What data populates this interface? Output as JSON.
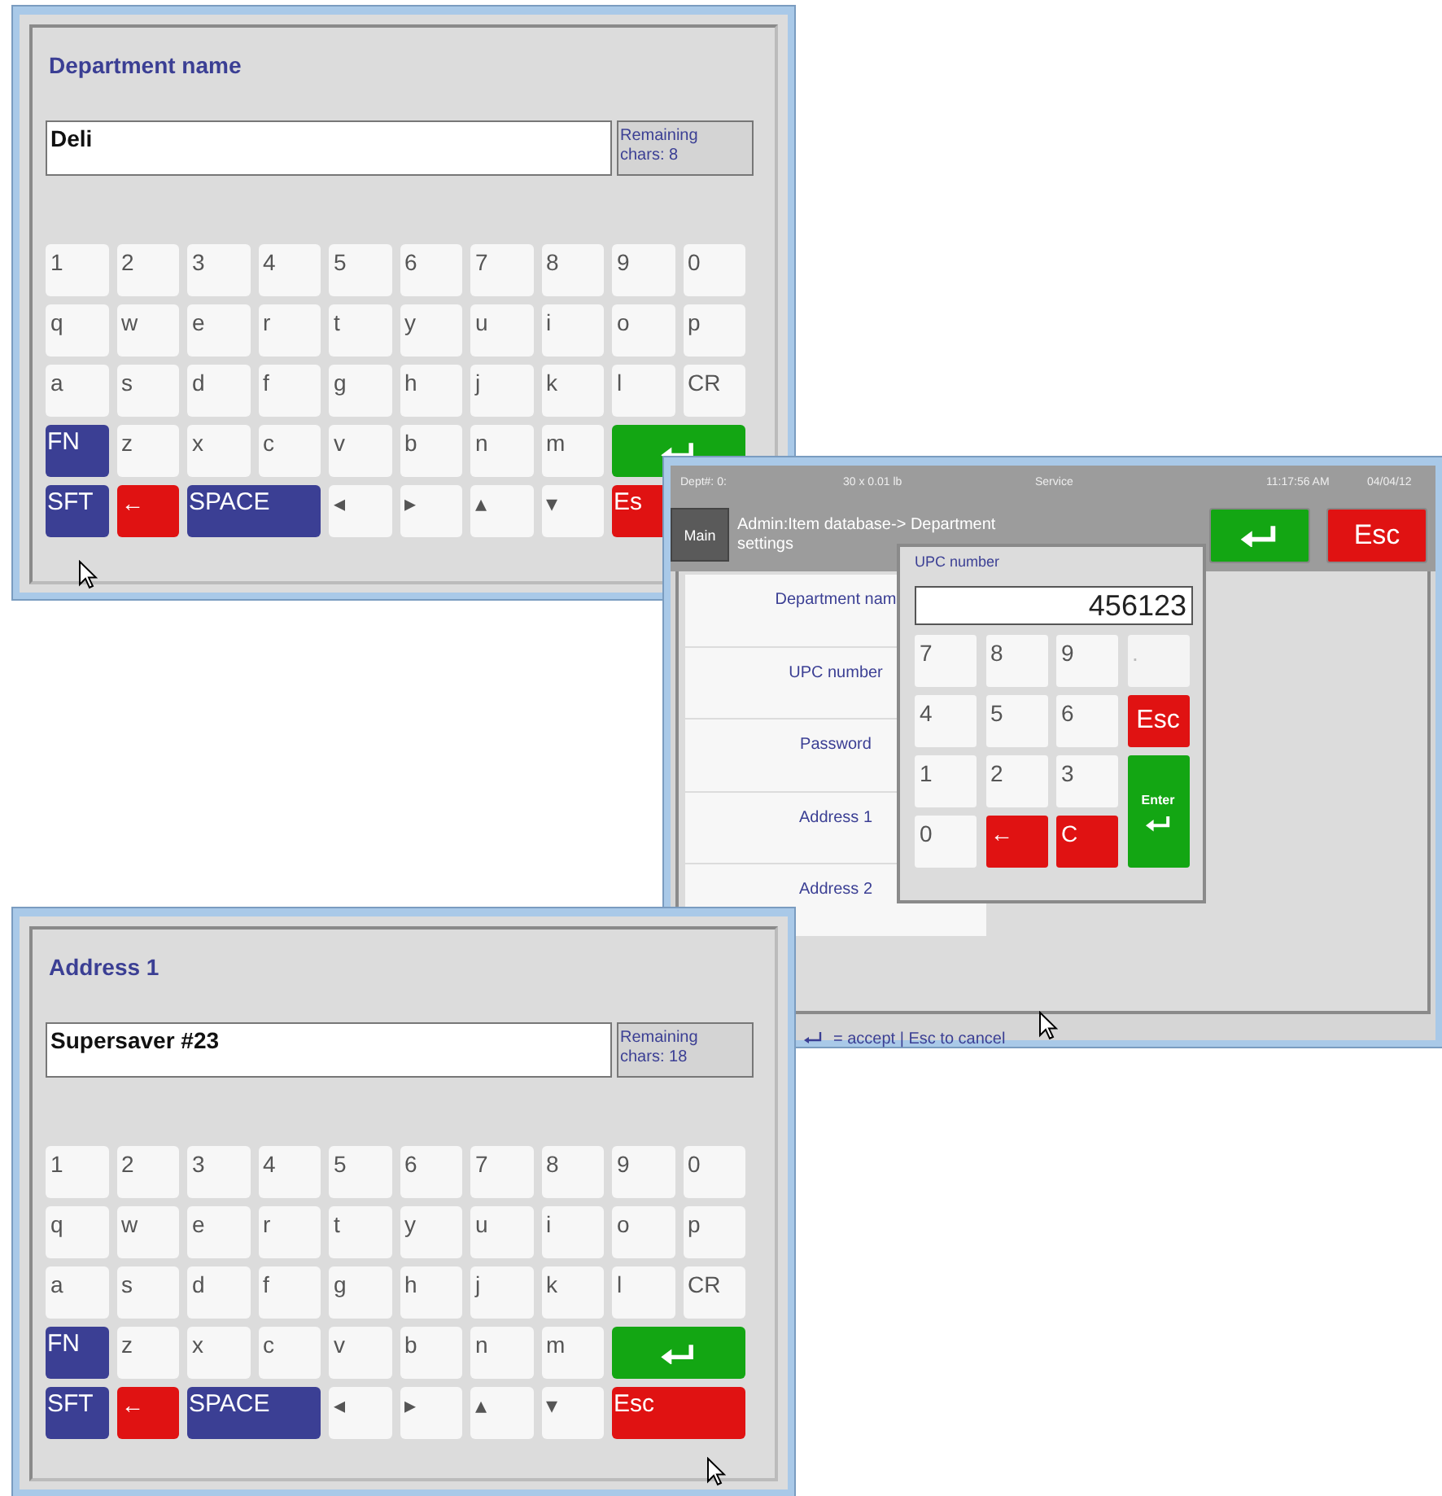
{
  "keyboard_window_1": {
    "title": "Department name",
    "value": "Deli",
    "remaining": "Remaining chars: 8",
    "keys": [
      {
        "label": "1",
        "kind": "char"
      },
      {
        "label": "2",
        "kind": "char"
      },
      {
        "label": "3",
        "kind": "char"
      },
      {
        "label": "4",
        "kind": "char"
      },
      {
        "label": "5",
        "kind": "char"
      },
      {
        "label": "6",
        "kind": "char"
      },
      {
        "label": "7",
        "kind": "char"
      },
      {
        "label": "8",
        "kind": "char"
      },
      {
        "label": "9",
        "kind": "char"
      },
      {
        "label": "0",
        "kind": "char"
      },
      {
        "label": "q",
        "kind": "char"
      },
      {
        "label": "w",
        "kind": "char"
      },
      {
        "label": "e",
        "kind": "char"
      },
      {
        "label": "r",
        "kind": "char"
      },
      {
        "label": "t",
        "kind": "char"
      },
      {
        "label": "y",
        "kind": "char"
      },
      {
        "label": "u",
        "kind": "char"
      },
      {
        "label": "i",
        "kind": "char"
      },
      {
        "label": "o",
        "kind": "char"
      },
      {
        "label": "p",
        "kind": "char"
      },
      {
        "label": "a",
        "kind": "char"
      },
      {
        "label": "s",
        "kind": "char"
      },
      {
        "label": "d",
        "kind": "char"
      },
      {
        "label": "f",
        "kind": "char"
      },
      {
        "label": "g",
        "kind": "char"
      },
      {
        "label": "h",
        "kind": "char"
      },
      {
        "label": "j",
        "kind": "char"
      },
      {
        "label": "k",
        "kind": "char"
      },
      {
        "label": "l",
        "kind": "char"
      },
      {
        "label": "CR",
        "kind": "char"
      },
      {
        "label": "FN",
        "kind": "function"
      },
      {
        "label": "z",
        "kind": "char"
      },
      {
        "label": "x",
        "kind": "char"
      },
      {
        "label": "c",
        "kind": "char"
      },
      {
        "label": "v",
        "kind": "char"
      },
      {
        "label": "b",
        "kind": "char"
      },
      {
        "label": "n",
        "kind": "char"
      },
      {
        "label": "m",
        "kind": "char"
      },
      {
        "kind": "enter"
      },
      {
        "label": "SFT",
        "kind": "function"
      },
      {
        "label": "←",
        "kind": "delete"
      },
      {
        "label": "SPACE",
        "kind": "space"
      },
      {
        "label": "◂",
        "kind": "char"
      },
      {
        "label": "▸",
        "kind": "char"
      },
      {
        "label": "▴",
        "kind": "char"
      },
      {
        "label": "▾",
        "kind": "char"
      },
      {
        "label": "Es",
        "kind": "escape"
      }
    ]
  },
  "admin_window": {
    "status": [
      "Dept#: 0:",
      "30 x 0.01 lb",
      "Service",
      "11:17:56 AM",
      "04/04/12"
    ],
    "main_button": "Main",
    "breadcrumb": "Admin:Item database-> Department settings",
    "escape_button": "Esc",
    "fields": [
      "Department nam",
      "UPC number",
      "Password",
      "Address 1",
      "Address 2"
    ],
    "popup": {
      "title": "UPC number",
      "value": "456123",
      "keys": [
        {
          "label": "7",
          "kind": "digit",
          "disabled": false
        },
        {
          "label": "8",
          "kind": "digit",
          "disabled": false
        },
        {
          "label": "9",
          "kind": "digit",
          "disabled": false
        },
        {
          "label": ".",
          "kind": "digit",
          "disabled": true
        },
        {
          "label": "4",
          "kind": "digit",
          "disabled": false
        },
        {
          "label": "5",
          "kind": "digit",
          "disabled": false
        },
        {
          "label": "6",
          "kind": "digit",
          "disabled": false
        },
        {
          "label": "Esc",
          "kind": "escape",
          "disabled": false
        },
        {
          "label": "1",
          "kind": "digit",
          "disabled": false
        },
        {
          "label": "2",
          "kind": "digit",
          "disabled": false
        },
        {
          "label": "3",
          "kind": "digit",
          "disabled": false
        },
        {
          "label": "Enter",
          "kind": "enter",
          "disabled": false
        },
        {
          "label": "0",
          "kind": "digit",
          "disabled": false
        },
        {
          "label": "←",
          "kind": "delete",
          "disabled": false
        },
        {
          "label": "C",
          "kind": "delete",
          "disabled": false
        }
      ]
    },
    "hint": "= accept | Esc to cancel"
  },
  "keyboard_window_2": {
    "title": "Address 1",
    "value": "Supersaver #23",
    "remaining": "Remaining chars: 18",
    "keys": [
      {
        "label": "1",
        "kind": "char"
      },
      {
        "label": "2",
        "kind": "char"
      },
      {
        "label": "3",
        "kind": "char"
      },
      {
        "label": "4",
        "kind": "char"
      },
      {
        "label": "5",
        "kind": "char"
      },
      {
        "label": "6",
        "kind": "char"
      },
      {
        "label": "7",
        "kind": "char"
      },
      {
        "label": "8",
        "kind": "char"
      },
      {
        "label": "9",
        "kind": "char"
      },
      {
        "label": "0",
        "kind": "char"
      },
      {
        "label": "q",
        "kind": "char"
      },
      {
        "label": "w",
        "kind": "char"
      },
      {
        "label": "e",
        "kind": "char"
      },
      {
        "label": "r",
        "kind": "char"
      },
      {
        "label": "t",
        "kind": "char"
      },
      {
        "label": "y",
        "kind": "char"
      },
      {
        "label": "u",
        "kind": "char"
      },
      {
        "label": "i",
        "kind": "char"
      },
      {
        "label": "o",
        "kind": "char"
      },
      {
        "label": "p",
        "kind": "char"
      },
      {
        "label": "a",
        "kind": "char"
      },
      {
        "label": "s",
        "kind": "char"
      },
      {
        "label": "d",
        "kind": "char"
      },
      {
        "label": "f",
        "kind": "char"
      },
      {
        "label": "g",
        "kind": "char"
      },
      {
        "label": "h",
        "kind": "char"
      },
      {
        "label": "j",
        "kind": "char"
      },
      {
        "label": "k",
        "kind": "char"
      },
      {
        "label": "l",
        "kind": "char"
      },
      {
        "label": "CR",
        "kind": "char"
      },
      {
        "label": "FN",
        "kind": "function"
      },
      {
        "label": "z",
        "kind": "char"
      },
      {
        "label": "x",
        "kind": "char"
      },
      {
        "label": "c",
        "kind": "char"
      },
      {
        "label": "v",
        "kind": "char"
      },
      {
        "label": "b",
        "kind": "char"
      },
      {
        "label": "n",
        "kind": "char"
      },
      {
        "label": "m",
        "kind": "char"
      },
      {
        "kind": "enter"
      },
      {
        "label": "SFT",
        "kind": "function"
      },
      {
        "label": "←",
        "kind": "delete"
      },
      {
        "label": "SPACE",
        "kind": "space"
      },
      {
        "label": "◂",
        "kind": "char"
      },
      {
        "label": "▸",
        "kind": "char"
      },
      {
        "label": "▴",
        "kind": "char"
      },
      {
        "label": "▾",
        "kind": "char"
      },
      {
        "label": "Esc",
        "kind": "escape"
      }
    ]
  }
}
